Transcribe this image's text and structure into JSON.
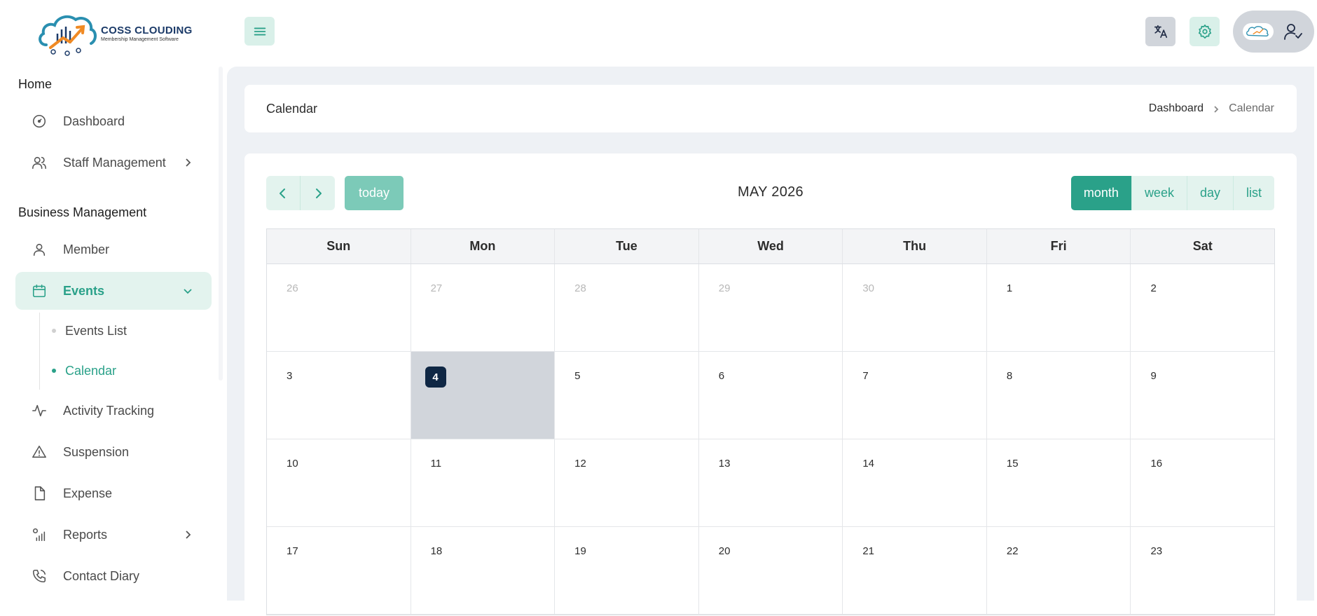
{
  "app": {
    "logo_title": "COSS CLOUDING",
    "logo_subtitle": "Membership Management Software"
  },
  "sidebar": {
    "sections": [
      {
        "title": "Home"
      },
      {
        "title": "Business Management"
      }
    ],
    "items": [
      {
        "label": "Dashboard",
        "icon": "gauge-icon"
      },
      {
        "label": "Staff Management",
        "icon": "users-icon",
        "has_children": true
      },
      {
        "label": "Member",
        "icon": "user-icon"
      },
      {
        "label": "Events",
        "icon": "calendar-icon",
        "expanded": true,
        "active": true
      },
      {
        "label": "Activity Tracking",
        "icon": "activity-icon"
      },
      {
        "label": "Suspension",
        "icon": "alert-triangle-icon"
      },
      {
        "label": "Expense",
        "icon": "file-icon"
      },
      {
        "label": "Reports",
        "icon": "report-chart-icon",
        "has_children": true
      },
      {
        "label": "Contact Diary",
        "icon": "phone-icon"
      }
    ],
    "events_children": [
      {
        "label": "Events List",
        "active": false
      },
      {
        "label": "Calendar",
        "active": true
      }
    ]
  },
  "header": {
    "menu_icon": "hamburger-icon",
    "language_icon": "translate-icon",
    "settings_icon": "gear-icon",
    "profile_icon": "user-check-icon"
  },
  "page": {
    "title": "Calendar",
    "breadcrumb": [
      "Dashboard",
      "Calendar"
    ]
  },
  "calendar": {
    "today_label": "today",
    "month_title": "MAY 2026",
    "views": [
      "month",
      "week",
      "day",
      "list"
    ],
    "active_view": "month",
    "weekdays": [
      "Sun",
      "Mon",
      "Tue",
      "Wed",
      "Thu",
      "Fri",
      "Sat"
    ],
    "weeks": [
      [
        {
          "d": "26",
          "other": true
        },
        {
          "d": "27",
          "other": true
        },
        {
          "d": "28",
          "other": true
        },
        {
          "d": "29",
          "other": true
        },
        {
          "d": "30",
          "other": true
        },
        {
          "d": "1"
        },
        {
          "d": "2"
        }
      ],
      [
        {
          "d": "3"
        },
        {
          "d": "4",
          "today": true
        },
        {
          "d": "5"
        },
        {
          "d": "6"
        },
        {
          "d": "7"
        },
        {
          "d": "8"
        },
        {
          "d": "9"
        }
      ],
      [
        {
          "d": "10"
        },
        {
          "d": "11"
        },
        {
          "d": "12"
        },
        {
          "d": "13"
        },
        {
          "d": "14"
        },
        {
          "d": "15"
        },
        {
          "d": "16"
        }
      ],
      [
        {
          "d": "17"
        },
        {
          "d": "18"
        },
        {
          "d": "19"
        },
        {
          "d": "20"
        },
        {
          "d": "21"
        },
        {
          "d": "22"
        },
        {
          "d": "23"
        }
      ]
    ]
  },
  "colors": {
    "accent": "#2aa189",
    "accent_light": "#e3f3ee",
    "today_badge": "#0f2744"
  }
}
